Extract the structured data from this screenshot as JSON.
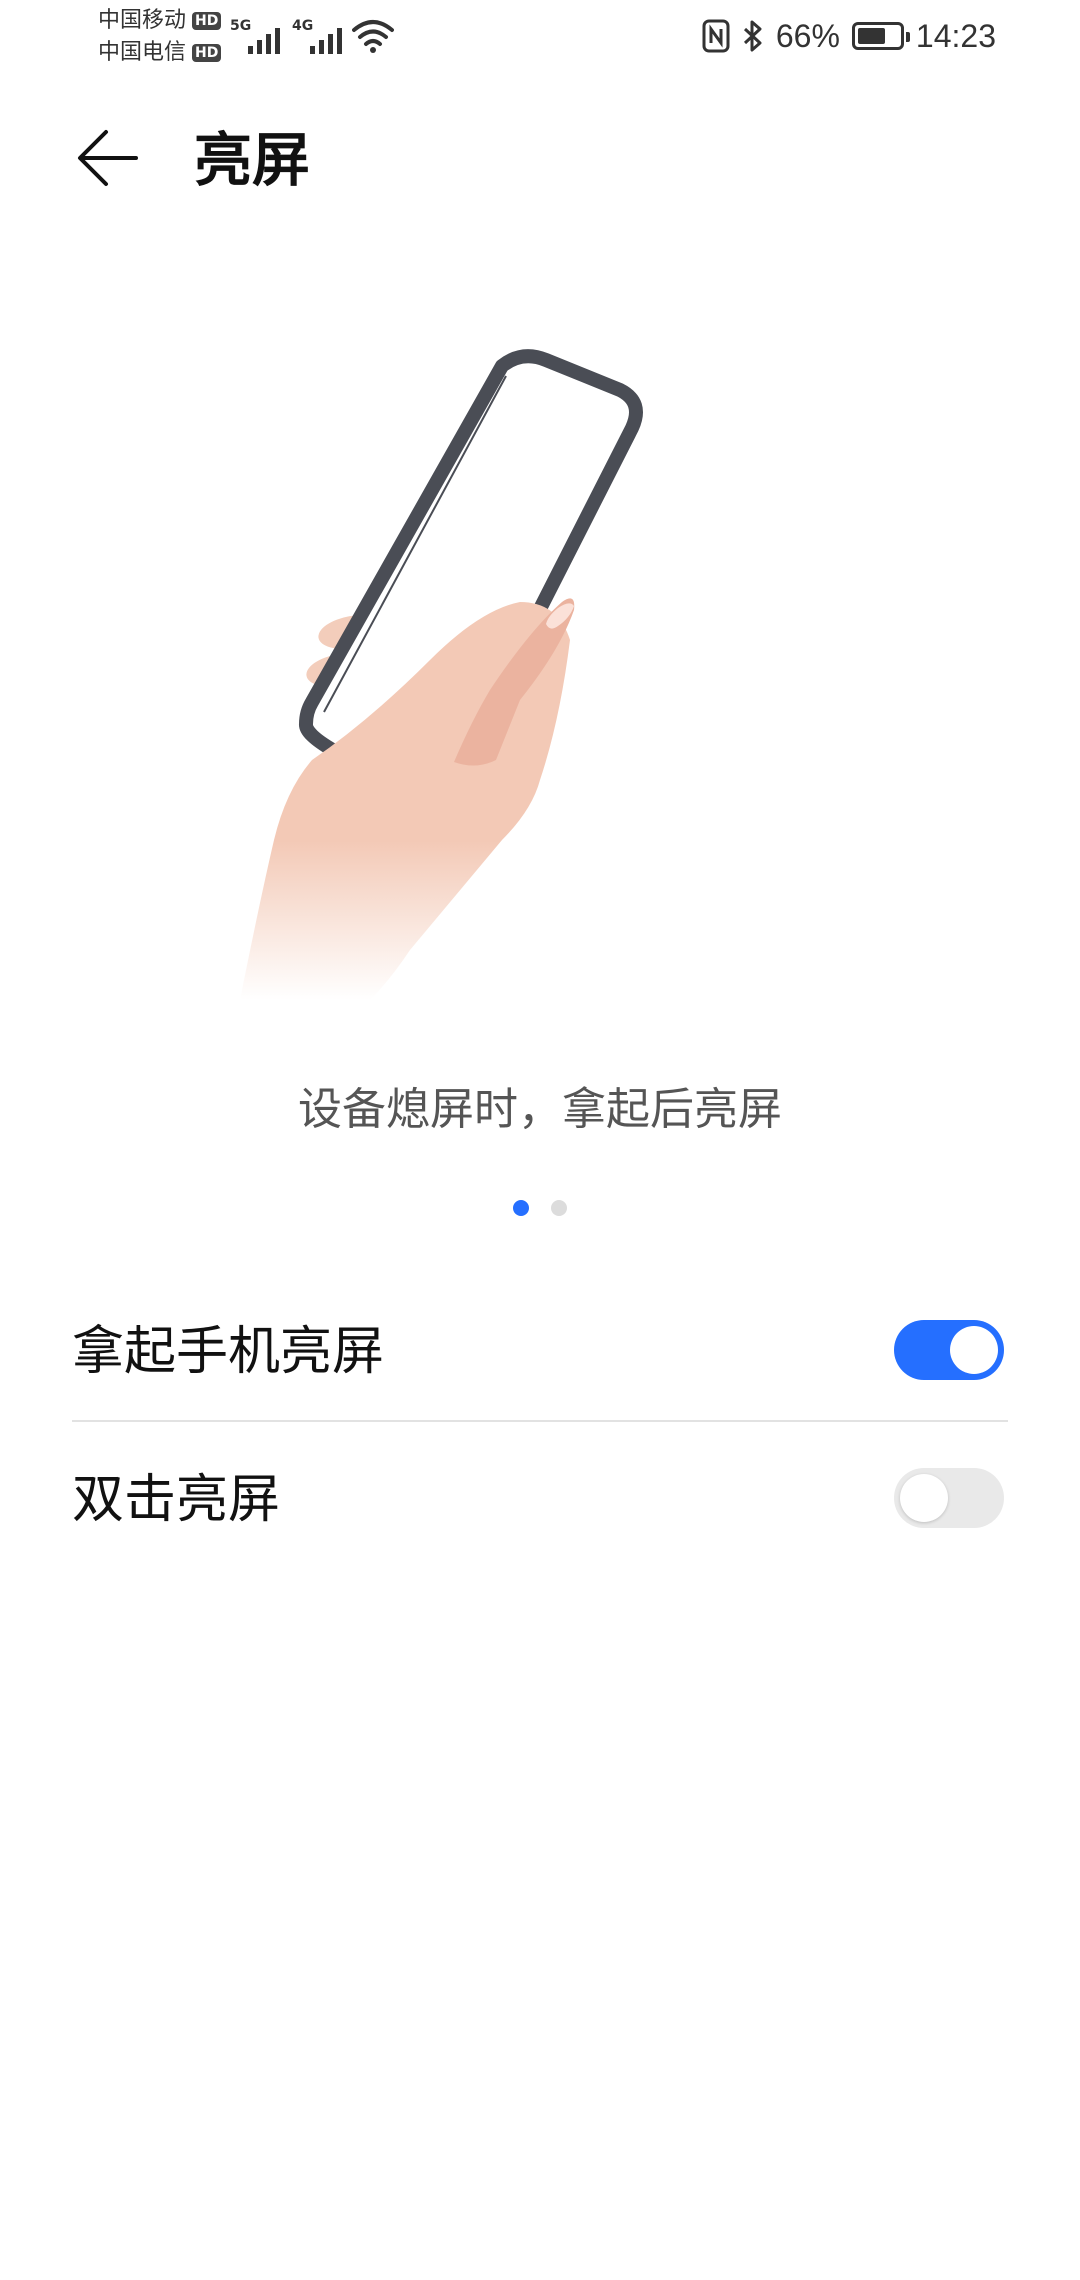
{
  "status_bar": {
    "carrier1": "中国移动",
    "carrier2": "中国电信",
    "hd_badge": "HD",
    "network1": "5G",
    "network2": "4G",
    "battery_percent": "66%",
    "time": "14:23",
    "icons": [
      "nfc-icon",
      "bluetooth-icon",
      "battery-icon",
      "wifi-icon",
      "signal-icon"
    ]
  },
  "app_bar": {
    "title": "亮屏",
    "back_icon": "arrow-left-icon"
  },
  "illustration": {
    "description_caption": "设备熄屏时，拿起后亮屏",
    "pager_total": 2,
    "pager_active": 1
  },
  "settings": [
    {
      "label": "拿起手机亮屏",
      "enabled": true
    },
    {
      "label": "双击亮屏",
      "enabled": false
    }
  ],
  "colors": {
    "accent": "#256fff",
    "switch_off": "#e9e9e9"
  }
}
